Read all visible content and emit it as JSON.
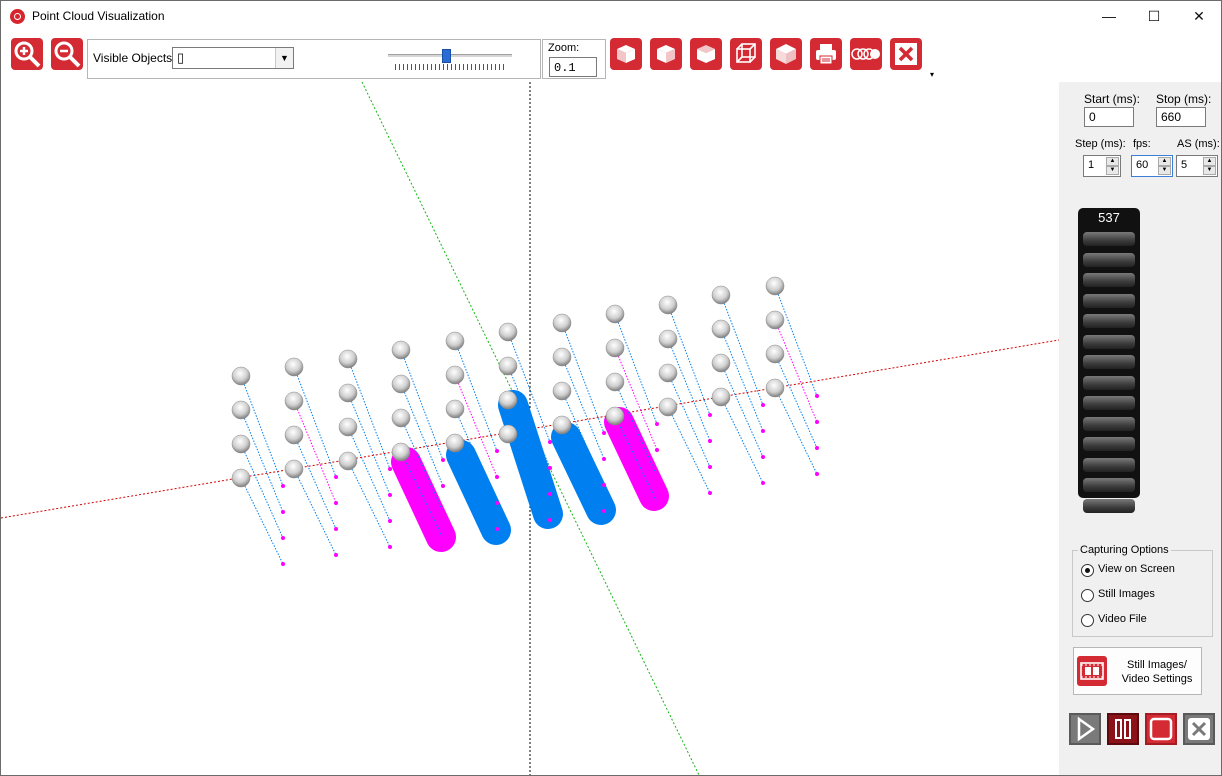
{
  "window": {
    "title": "Point Cloud Visualization",
    "minimize": "—",
    "maximize": "☐",
    "close": "✕"
  },
  "toolbar": {
    "visible_objects_label": "Visible Objects:",
    "visible_objects_value": "▯",
    "zoom_label": "Zoom:",
    "zoom_value": "0.1",
    "zoom_slider_level": 0.45,
    "buttons": [
      "zoom-in",
      "zoom-out",
      "view-front",
      "view-right",
      "view-left",
      "view-wireframe",
      "view-solid",
      "print",
      "toggle-points",
      "close-all"
    ],
    "accent": "#d42a33"
  },
  "panel": {
    "start_label": "Start (ms):",
    "start_value": "0",
    "stop_label": "Stop (ms):",
    "stop_value": "660",
    "step_label": "Step (ms):",
    "step_value": "1",
    "fps_label": "fps:",
    "fps_value": "60",
    "as_label": "AS (ms):",
    "as_value": "5",
    "frame_counter": "537",
    "capturing_title": "Capturing Options",
    "options": [
      "View on Screen",
      "Still Images",
      "Video File"
    ],
    "selected_option": "View on Screen",
    "settings_button": "Still Images/\nVideo Settings",
    "playback": [
      "play",
      "pause",
      "stop",
      "close"
    ]
  },
  "scene": {
    "colors": {
      "x_axis": "#d40000",
      "y_axis": "#15b515",
      "z_axis": "#000000",
      "magenta": "#ff00ff",
      "blue": "#0080f0",
      "sphere": "#d8d8d8"
    }
  }
}
